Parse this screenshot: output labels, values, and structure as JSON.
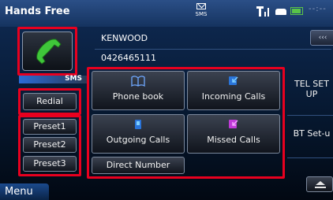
{
  "header": {
    "title": "Hands Free",
    "sms_indicator": "SMS",
    "clock": "--:--",
    "icons": [
      "sms-envelope-icon",
      "signal-strength-icon",
      "car-connection-icon",
      "battery-icon"
    ]
  },
  "device": {
    "name": "KENWOOD",
    "number": "0426465111",
    "back_label": "‹‹‹"
  },
  "sms_tab": {
    "label": "SMS"
  },
  "left_buttons": {
    "redial": "Redial",
    "presets": [
      "Preset1",
      "Preset2",
      "Preset3"
    ]
  },
  "grid": {
    "phonebook": "Phone book",
    "incoming": "Incoming Calls",
    "outgoing": "Outgoing Calls",
    "missed": "Missed Calls",
    "direct": "Direct Number"
  },
  "side": {
    "tel_setup": "TEL SET UP",
    "bt_setup": "BT Set-u"
  },
  "footer": {
    "menu": "Menu"
  },
  "colors": {
    "highlight": "#e8001f",
    "call_green": "#3fc63a",
    "background": "#0f2b55"
  }
}
